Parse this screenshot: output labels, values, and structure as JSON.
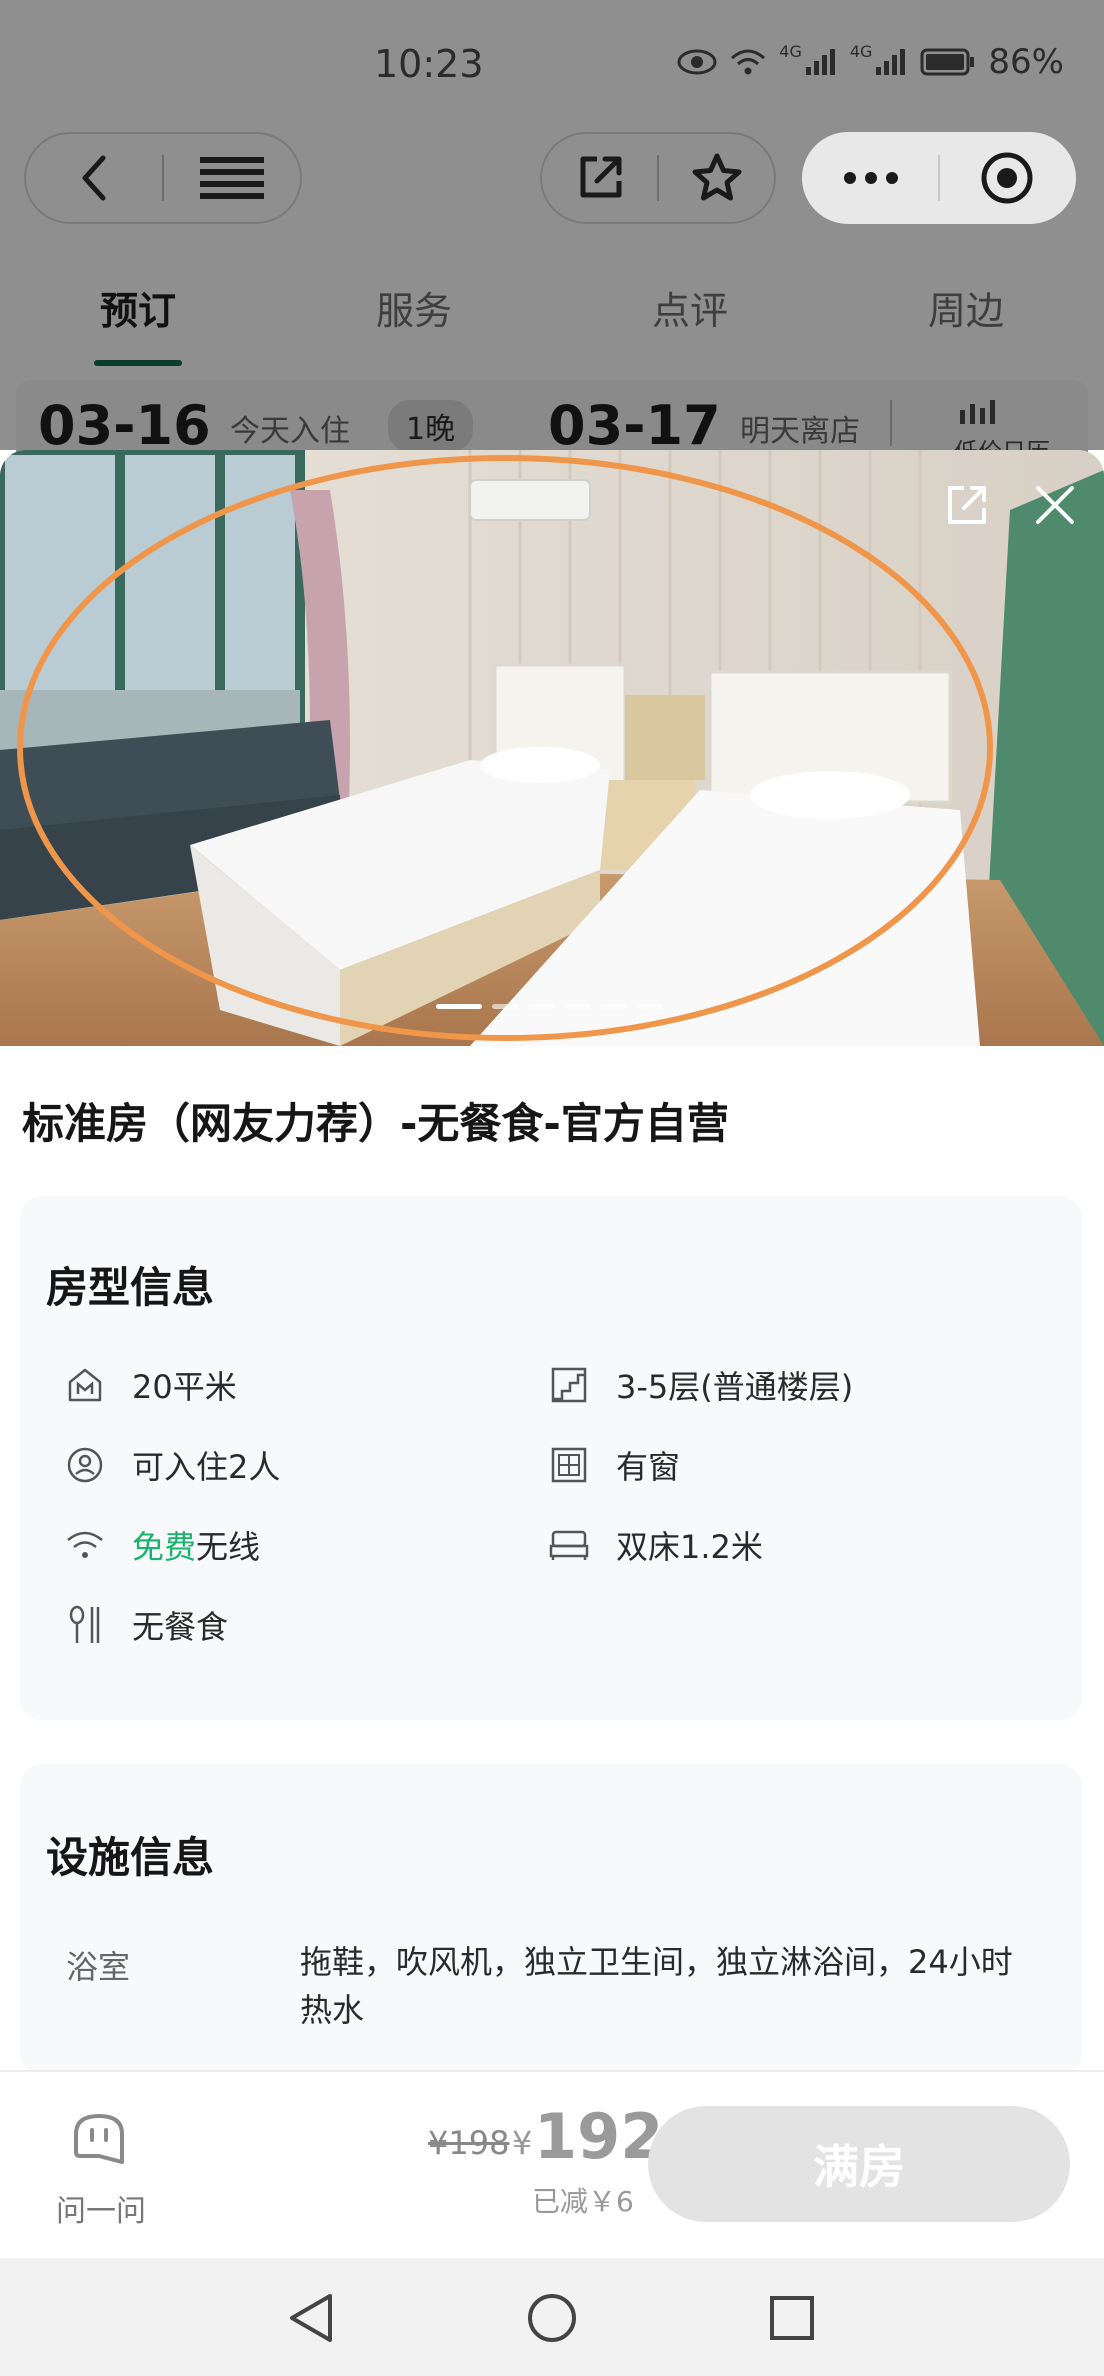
{
  "status": {
    "time": "10:23",
    "signal_a": "4G",
    "signal_b": "4G",
    "battery": "86%"
  },
  "tabs": [
    {
      "label": "预订"
    },
    {
      "label": "服务"
    },
    {
      "label": "点评"
    },
    {
      "label": "周边"
    }
  ],
  "dates": {
    "checkin": "03-16",
    "checkin_label": "今天入住",
    "nights": "1晚",
    "checkout": "03-17",
    "checkout_label": "明天离店",
    "calendar_label": "低价日历"
  },
  "room": {
    "title": "标准房（网友力荐）-无餐食-官方自营"
  },
  "room_info": {
    "title": "房型信息",
    "items": [
      {
        "text": "20平米"
      },
      {
        "text": "3-5层(普通楼层)"
      },
      {
        "text": "可入住2人"
      },
      {
        "text": "有窗"
      },
      {
        "highlight": "免费",
        "text": "无线"
      },
      {
        "text": "双床1.2米"
      },
      {
        "text": "无餐食"
      }
    ]
  },
  "facilities": {
    "title": "设施信息",
    "label": "浴室",
    "value": "拖鞋，吹风机，独立卫生间，独立淋浴间，24小时热水"
  },
  "bottom": {
    "ask_label": "问一问",
    "old_price": "¥198",
    "currency": "¥",
    "price": "192",
    "discount": "已减￥6",
    "full_button": "满房"
  },
  "colors": {
    "accent": "#19b36b",
    "annotation": "#f0964a"
  }
}
